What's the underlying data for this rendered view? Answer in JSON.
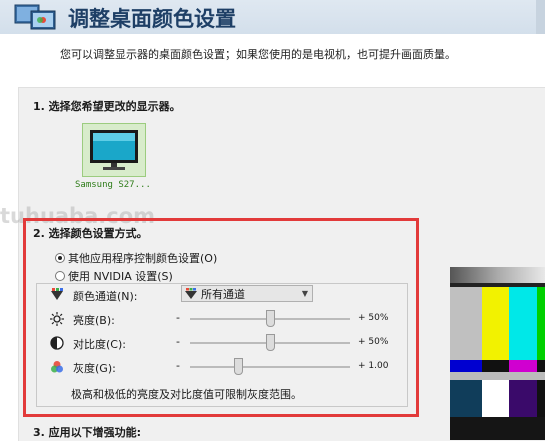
{
  "header": {
    "title": "调整桌面颜色设置"
  },
  "subtitle": "您可以调整显示器的桌面颜色设置；如果您使用的是电视机，也可提升画面质量。",
  "watermark": "tuhuaba.com",
  "section1": {
    "label": "1. 选择您希望更改的显示器。",
    "monitor_name": "Samsung S27..."
  },
  "section2": {
    "label": "2. 选择颜色设置方式。",
    "options": [
      {
        "label": "其他应用程序控制颜色设置(O)",
        "selected": true
      },
      {
        "label": "使用 NVIDIA 设置(S)",
        "selected": false
      }
    ],
    "channel": {
      "label": "颜色通道(N):",
      "value": "所有通道"
    },
    "sliders": [
      {
        "label": "亮度(B):",
        "minus": "-",
        "value_text": "+ 50%",
        "level": 0.5,
        "icon": "sun-icon"
      },
      {
        "label": "对比度(C):",
        "minus": "-",
        "value_text": "+ 50%",
        "level": 0.5,
        "icon": "contrast-icon"
      },
      {
        "label": "灰度(G):",
        "minus": "-",
        "value_text": "+ 1.00",
        "level": 0.3,
        "icon": "color-circles-icon"
      }
    ],
    "note": "极高和极低的亮度及对比度值可限制灰度范围。"
  },
  "section3": {
    "label": "3. 应用以下增强功能:"
  },
  "colors": {
    "accent_red": "#e23a3a",
    "title_blue": "#1e3f66",
    "monitor_green": "#2f7d1a"
  }
}
